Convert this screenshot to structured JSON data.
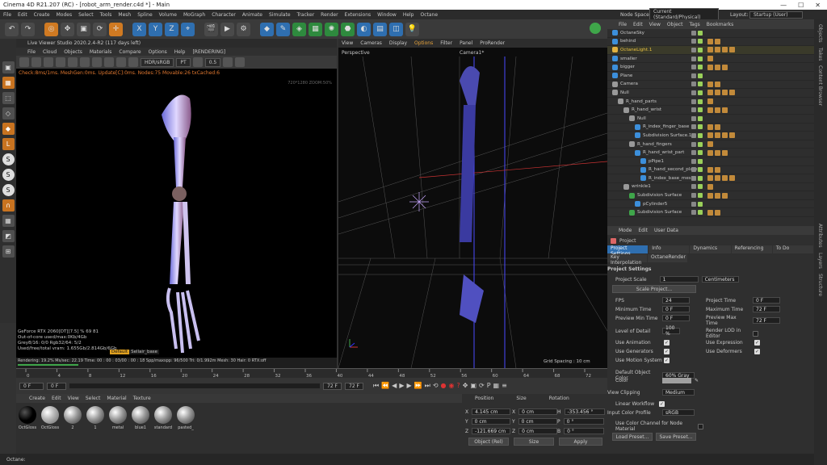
{
  "window": {
    "title": "Cinema 4D R21.207 (RC) - [robot_arm_render.c4d *] - Main",
    "controls": [
      "—",
      "☐",
      "✕"
    ]
  },
  "menu": [
    "File",
    "Edit",
    "Create",
    "Modes",
    "Select",
    "Tools",
    "Mesh",
    "Spline",
    "Volume",
    "MoGraph",
    "Character",
    "Animate",
    "Simulate",
    "Tracker",
    "Render",
    "Extensions",
    "Window",
    "Help",
    "Octane"
  ],
  "top_right": {
    "node_space_label": "Node Space:",
    "node_space_value": "Current (Standard/Physical)",
    "layout_label": "Layout:",
    "layout_value": "Startup (User)"
  },
  "live_viewer": {
    "title": "Live Viewer Studio 2020.2.4-R2 (117 days left)",
    "menu": [
      "File",
      "Cloud",
      "Objects",
      "Materials",
      "Compare",
      "Options",
      "Help",
      "[RENDERING]"
    ],
    "color_mode": "HDR/sRGB",
    "pt": "PT",
    "zoom": "0.5",
    "stat_line": "Check:8ms/1ms. MeshGen:0ms. Update[C]:0ms. Nodes:75 Movable:26 txCached:6",
    "resolution": "720*1280 ZOOM:50%",
    "gpu": "GeForce RTX 2060[DT][7.5]   % 69   81",
    "mem1": "Out-of-core used/max:0Kb/4Gb",
    "mem2": "Grey8/16: 0/0        Rgb32/64: 5/2",
    "mem3": "Used/free/total vram: 1.655Gb/2.814Gb/6Gb",
    "render_tag": "Default",
    "render_tag2": "Sellair_base",
    "footer": "Rendering: 19.2%   Ms/sec: 22.19   Time: 00 : 00 : 03/00 : 00 : 18   Spp/maxspp: 96/500   Tri: 0/1.992m   Mesh: 30   Hair: 0   RTX:off"
  },
  "viewport": {
    "menu": [
      "View",
      "Cameras",
      "Display",
      "Options",
      "Filter",
      "Panel",
      "ProRender"
    ],
    "label": "Perspective",
    "camera": "Camera1*",
    "grid": "Grid Spacing : 10 cm"
  },
  "object_manager": {
    "menu": [
      "File",
      "Edit",
      "View",
      "Object",
      "Tags",
      "Bookmarks"
    ],
    "objects": [
      {
        "name": "OctaneSky",
        "indent": 0,
        "color": "#3c8fdb"
      },
      {
        "name": "behind",
        "indent": 0,
        "color": "#3c8fdb"
      },
      {
        "name": "OctaneLight.1",
        "indent": 0,
        "color": "#e0b040",
        "hl": true
      },
      {
        "name": "smaller",
        "indent": 0,
        "color": "#3c8fdb"
      },
      {
        "name": "bigger",
        "indent": 0,
        "color": "#3c8fdb"
      },
      {
        "name": "Plane",
        "indent": 0,
        "color": "#3c8fdb"
      },
      {
        "name": "Camera",
        "indent": 0,
        "color": "#999"
      },
      {
        "name": "Null",
        "indent": 0,
        "color": "#999"
      },
      {
        "name": "R_hand_parts",
        "indent": 1,
        "color": "#999"
      },
      {
        "name": "R_hand_wrist",
        "indent": 2,
        "color": "#999"
      },
      {
        "name": "Null",
        "indent": 3,
        "color": "#999"
      },
      {
        "name": "R_index_finger_base",
        "indent": 4,
        "color": "#3c8fdb"
      },
      {
        "name": "Subdivision Surface.1",
        "indent": 4,
        "color": "#3c8fdb"
      },
      {
        "name": "R_hand_fingers",
        "indent": 3,
        "color": "#999"
      },
      {
        "name": "R_hand_wrist_part",
        "indent": 4,
        "color": "#3c8fdb"
      },
      {
        "name": "pPipe1",
        "indent": 5,
        "color": "#3c8fdb"
      },
      {
        "name": "R_hand_second_plates",
        "indent": 5,
        "color": "#3c8fdb"
      },
      {
        "name": "R_index_base_mesh",
        "indent": 5,
        "color": "#3c8fdb"
      },
      {
        "name": "wrinkle1",
        "indent": 2,
        "color": "#999"
      },
      {
        "name": "Subdivision Surface",
        "indent": 3,
        "color": "#3fa64a"
      },
      {
        "name": "pCylinder5",
        "indent": 4,
        "color": "#3c8fdb"
      },
      {
        "name": "Subdivision Surface",
        "indent": 3,
        "color": "#3fa64a"
      }
    ]
  },
  "attributes": {
    "menu": [
      "Mode",
      "Edit",
      "User Data"
    ],
    "object": "Project",
    "tabs": [
      "Project Settings",
      "Info",
      "Dynamics",
      "Referencing",
      "To Do"
    ],
    "tabs2": [
      "Key Interpolation",
      "OctaneRender"
    ],
    "section": "Project Settings",
    "project_scale_label": "Project Scale",
    "project_scale": "1",
    "project_scale_unit": "Centimeters",
    "scale_project": "Scale Project...",
    "fps_label": "FPS",
    "fps": "24",
    "project_time_label": "Project Time",
    "project_time": "0 F",
    "min_time_label": "Minimum Time",
    "min_time": "0 F",
    "max_time_label": "Maximum Time",
    "max_time": "72 F",
    "prev_min_label": "Preview Min Time",
    "prev_min": "0 F",
    "prev_max_label": "Preview Max Time",
    "prev_max": "72 F",
    "lod_label": "Level of Detail",
    "lod": "100 %",
    "render_lod_label": "Render LOD in Editor",
    "use_anim": "Use Animation",
    "use_expr": "Use Expression",
    "use_gen": "Use Generators",
    "use_def": "Use Deformers",
    "use_motion": "Use Motion System",
    "def_color_label": "Default Object Color",
    "def_color": "60% Gray",
    "color_label": "Color",
    "view_clip_label": "View Clipping",
    "view_clip": "Medium",
    "linear_label": "Linear Workflow",
    "icp_label": "Input Color Profile",
    "icp": "sRGB",
    "use_color_channel": "Use Color Channel for Node Material",
    "load_preset": "Load Preset...",
    "save_preset": "Save Preset..."
  },
  "side_tabs_top": [
    "Objects",
    "Takes",
    "Content Browser"
  ],
  "side_tabs_bot": [
    "Attributes",
    "Layers",
    "Structure"
  ],
  "timeline": {
    "ticks": [
      "0",
      "4",
      "8",
      "12",
      "16",
      "20",
      "24",
      "28",
      "32",
      "36",
      "40",
      "44",
      "48",
      "52",
      "56",
      "60",
      "64",
      "68",
      "72"
    ],
    "current": "0 F",
    "start": "0 F",
    "end": "72 F",
    "end2": "72 F"
  },
  "materials": {
    "menu": [
      "Create",
      "Edit",
      "View",
      "Select",
      "Material",
      "Texture"
    ],
    "items": [
      "OctGloss",
      "OctGloss",
      "2",
      "1",
      "metal",
      "blue1",
      "standard",
      "pasted_"
    ]
  },
  "coords": {
    "headers": [
      "Position",
      "Size",
      "Rotation"
    ],
    "x": "4.145 cm",
    "y": "0 cm",
    "z": "-121.669 cm",
    "sx": "0 cm",
    "sy": "0 cm",
    "sz": "0 cm",
    "h": "-353.456 °",
    "p": "0 °",
    "b": "0 °",
    "mode": "Object (Rel)",
    "size_mode": "Size",
    "apply": "Apply"
  },
  "status": "Octane:"
}
